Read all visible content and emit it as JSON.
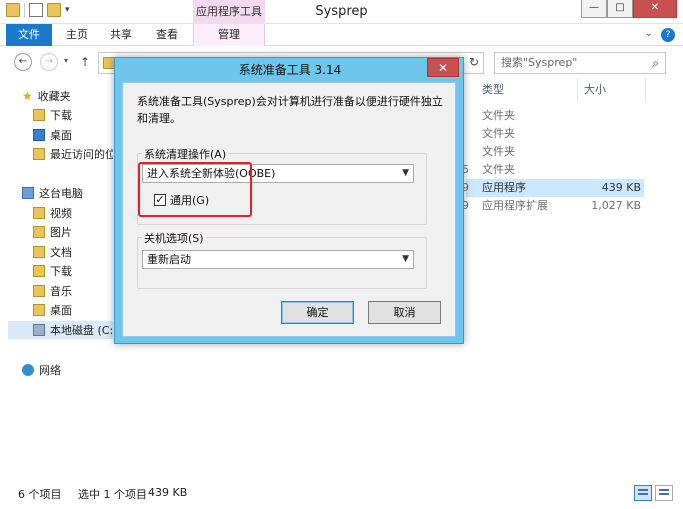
{
  "window": {
    "title": "Sysprep",
    "context_tab_group": "应用程序工具",
    "controls": {
      "minimize": "—",
      "maximize": "□",
      "close": "✕"
    }
  },
  "ribbon": {
    "tabs": [
      "文件",
      "主页",
      "共享",
      "查看",
      "管理"
    ]
  },
  "address": {
    "search_placeholder": "搜索\"Sysprep\""
  },
  "nav": {
    "favorites": "收藏夹",
    "fav_items": [
      "下载",
      "桌面",
      "最近访问的位置"
    ],
    "this_pc": "这台电脑",
    "pc_items": [
      "视频",
      "图片",
      "文档",
      "下载",
      "音乐",
      "桌面"
    ],
    "local_disk": "本地磁盘 (C:)",
    "network": "网络"
  },
  "file_list": {
    "columns": {
      "type": "类型",
      "size": "大小"
    },
    "rows": [
      {
        "date_tail": "",
        "type": "文件夹",
        "size": ""
      },
      {
        "date_tail": "",
        "type": "文件夹",
        "size": ""
      },
      {
        "date_tail": "",
        "type": "文件夹",
        "size": ""
      },
      {
        "date_tail": "5",
        "type": "文件夹",
        "size": ""
      },
      {
        "date_tail": "9",
        "type": "应用程序",
        "size": "439 KB"
      },
      {
        "date_tail": "9",
        "type": "应用程序扩展",
        "size": "1,027 KB"
      }
    ]
  },
  "status": {
    "count": "6 个项目",
    "selected": "选中 1 个项目",
    "selected_size": "439 KB"
  },
  "dialog": {
    "title": "系统准备工具 3.14",
    "close": "✕",
    "description": "系统准备工具(Sysprep)会对计算机进行准备以便进行硬件独立和清理。",
    "cleanup_label": "系统清理操作(A)",
    "cleanup_value": "进入系统全新体验(OOBE)",
    "generalize_label": "通用(G)",
    "generalize_checked": true,
    "shutdown_label": "关机选项(S)",
    "shutdown_value": "重新启动",
    "ok": "确定",
    "cancel": "取消"
  },
  "colors": {
    "accent": "#1979ca",
    "dialog_frame": "#6fc5ea",
    "highlight": "#e0202b",
    "selected_row": "#cce8ff"
  }
}
